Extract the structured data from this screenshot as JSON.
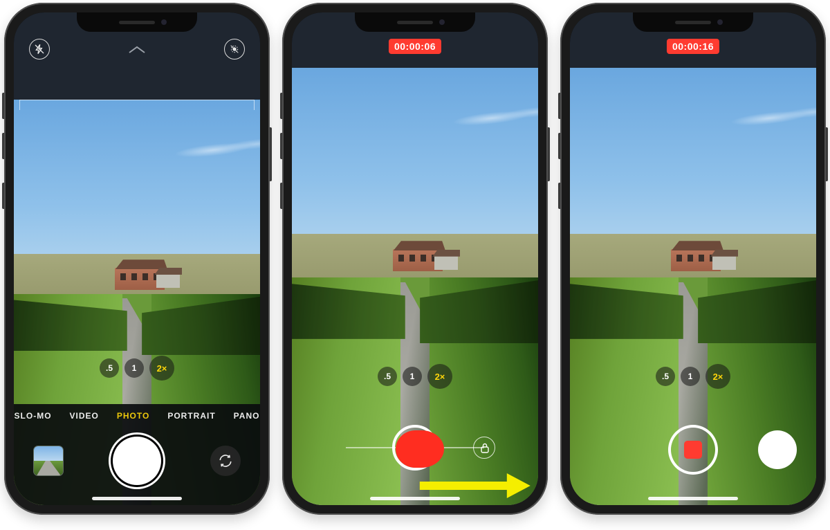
{
  "phones": [
    {
      "id": "photo-mode",
      "recording_badge": null,
      "topbar": {
        "flash": true,
        "chevron": true,
        "live": true
      },
      "zoom": {
        "options": [
          ".5",
          "1",
          "2×"
        ],
        "active_index": 2
      },
      "modes": {
        "items": [
          "SLO-MO",
          "VIDEO",
          "PHOTO",
          "PORTRAIT",
          "PANO"
        ],
        "active_index": 2
      },
      "controls": {
        "thumbnail": true,
        "shutter": "photo",
        "flip": true
      }
    },
    {
      "id": "quicktake-drag",
      "recording_badge": "00:00:06",
      "topbar": {
        "flash": false,
        "chevron": false,
        "live": false
      },
      "zoom": {
        "options": [
          ".5",
          "1",
          "2×"
        ],
        "active_index": 2
      },
      "quicktake": {
        "lock_icon": "lock-icon",
        "arrow_hint": true
      }
    },
    {
      "id": "video-locked",
      "recording_badge": "00:00:16",
      "topbar": {
        "flash": false,
        "chevron": false,
        "live": false
      },
      "zoom": {
        "options": [
          ".5",
          "1",
          "2×"
        ],
        "active_index": 2
      },
      "controls": {
        "stop": true,
        "still": true
      }
    }
  ]
}
